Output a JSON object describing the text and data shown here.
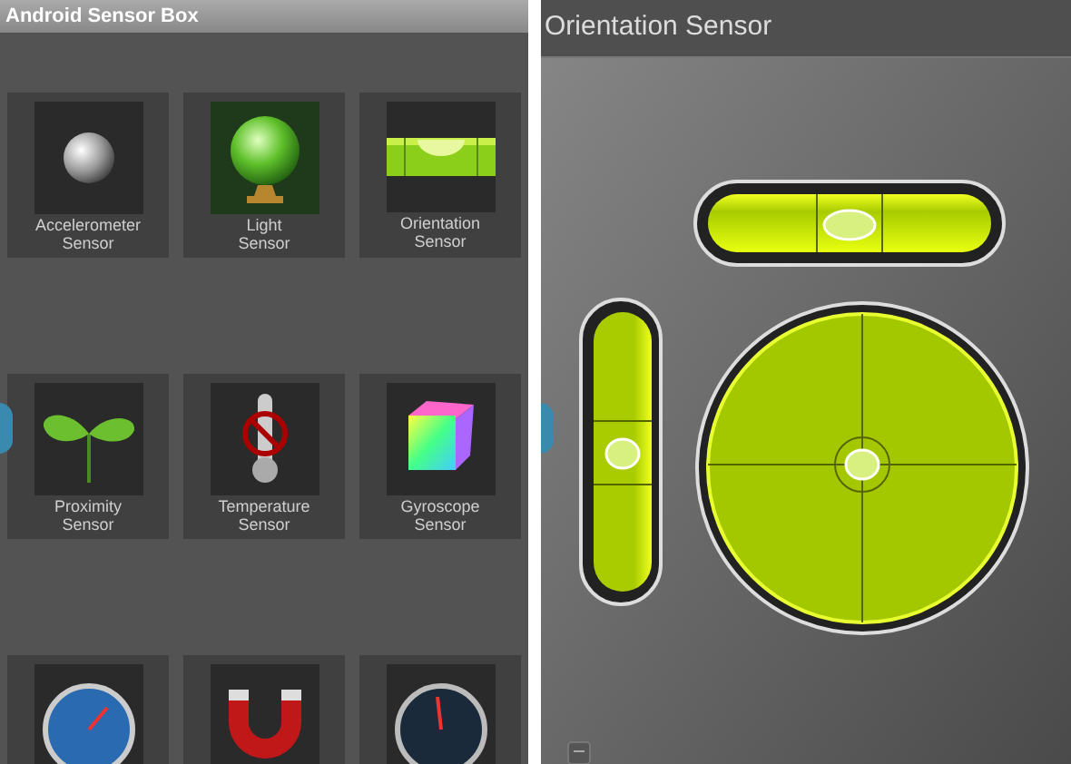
{
  "sensor_box": {
    "title": "Android Sensor Box",
    "sensors": [
      {
        "kind": "sphere",
        "lines": [
          "Accelerometer",
          "Sensor"
        ]
      },
      {
        "kind": "crystal-ball",
        "lines": [
          "Light",
          "Sensor"
        ]
      },
      {
        "kind": "level",
        "lines": [
          "Orientation",
          "Sensor"
        ]
      },
      {
        "kind": "sprout",
        "lines": [
          "Proximity",
          "Sensor"
        ]
      },
      {
        "kind": "thermometer",
        "lines": [
          "Temperature",
          "Sensor"
        ]
      },
      {
        "kind": "cube",
        "lines": [
          "Gyroscope",
          "Sensor"
        ]
      },
      {
        "kind": "gauge"
      },
      {
        "kind": "magnet"
      },
      {
        "kind": "speedometer"
      }
    ]
  },
  "orientation": {
    "title": "Orientation Sensor"
  }
}
